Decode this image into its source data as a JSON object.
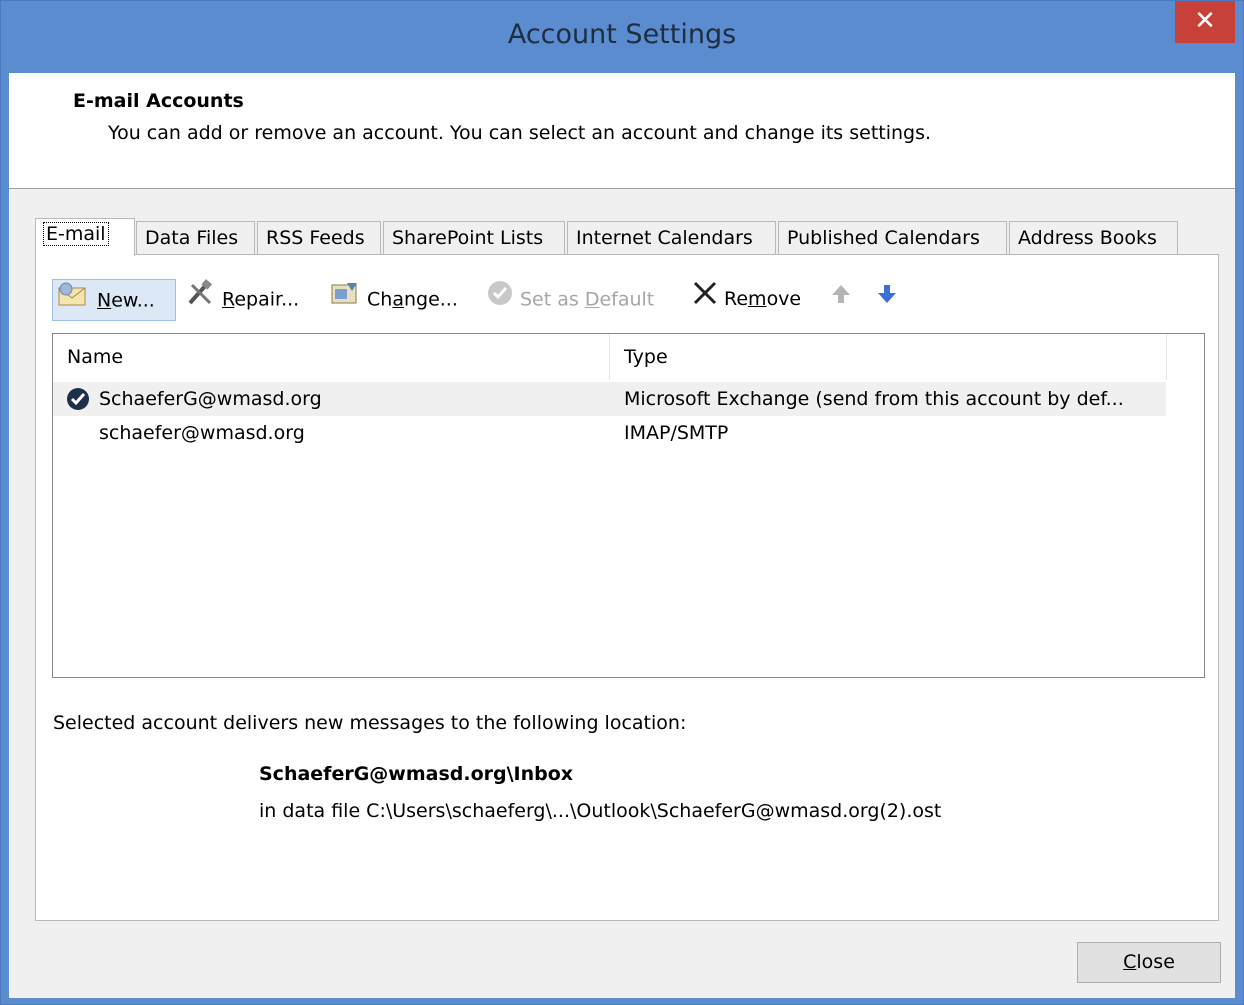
{
  "window": {
    "title": "Account Settings",
    "close_glyph": "✕"
  },
  "header": {
    "title": "E-mail Accounts",
    "description": "You can add or remove an account. You can select an account and change its settings."
  },
  "tabs": [
    {
      "label": "E-mail",
      "active": true
    },
    {
      "label": "Data Files"
    },
    {
      "label": "RSS Feeds"
    },
    {
      "label": "SharePoint Lists"
    },
    {
      "label": "Internet Calendars"
    },
    {
      "label": "Published Calendars"
    },
    {
      "label": "Address Books"
    }
  ],
  "toolbar": {
    "new": {
      "pre": "",
      "u": "N",
      "post": "ew..."
    },
    "repair": {
      "pre": "",
      "u": "R",
      "post": "epair..."
    },
    "change": {
      "pre": "Ch",
      "u": "a",
      "post": "nge..."
    },
    "set_default": {
      "pre": "Set as ",
      "u": "D",
      "post": "efault"
    },
    "remove": {
      "pre": "Re",
      "u": "m",
      "post": "ove"
    }
  },
  "list": {
    "columns": [
      "Name",
      "Type"
    ],
    "rows": [
      {
        "name": "SchaeferG@wmasd.org",
        "type": "Microsoft Exchange (send from this account by def...",
        "default": true
      },
      {
        "name": "schaefer@wmasd.org",
        "type": "IMAP/SMTP",
        "default": false
      }
    ]
  },
  "location": {
    "label": "Selected account delivers new messages to the following location:",
    "path": "SchaeferG@wmasd.org\\Inbox",
    "file": "in data file C:\\Users\\schaeferg\\...\\Outlook\\SchaeferG@wmasd.org(2).ost"
  },
  "close_button": {
    "u": "C",
    "post": "lose"
  },
  "colors": {
    "titlebar": "#5b8cd0",
    "close": "#c7413a",
    "accent_arrow": "#3a6fd8"
  }
}
